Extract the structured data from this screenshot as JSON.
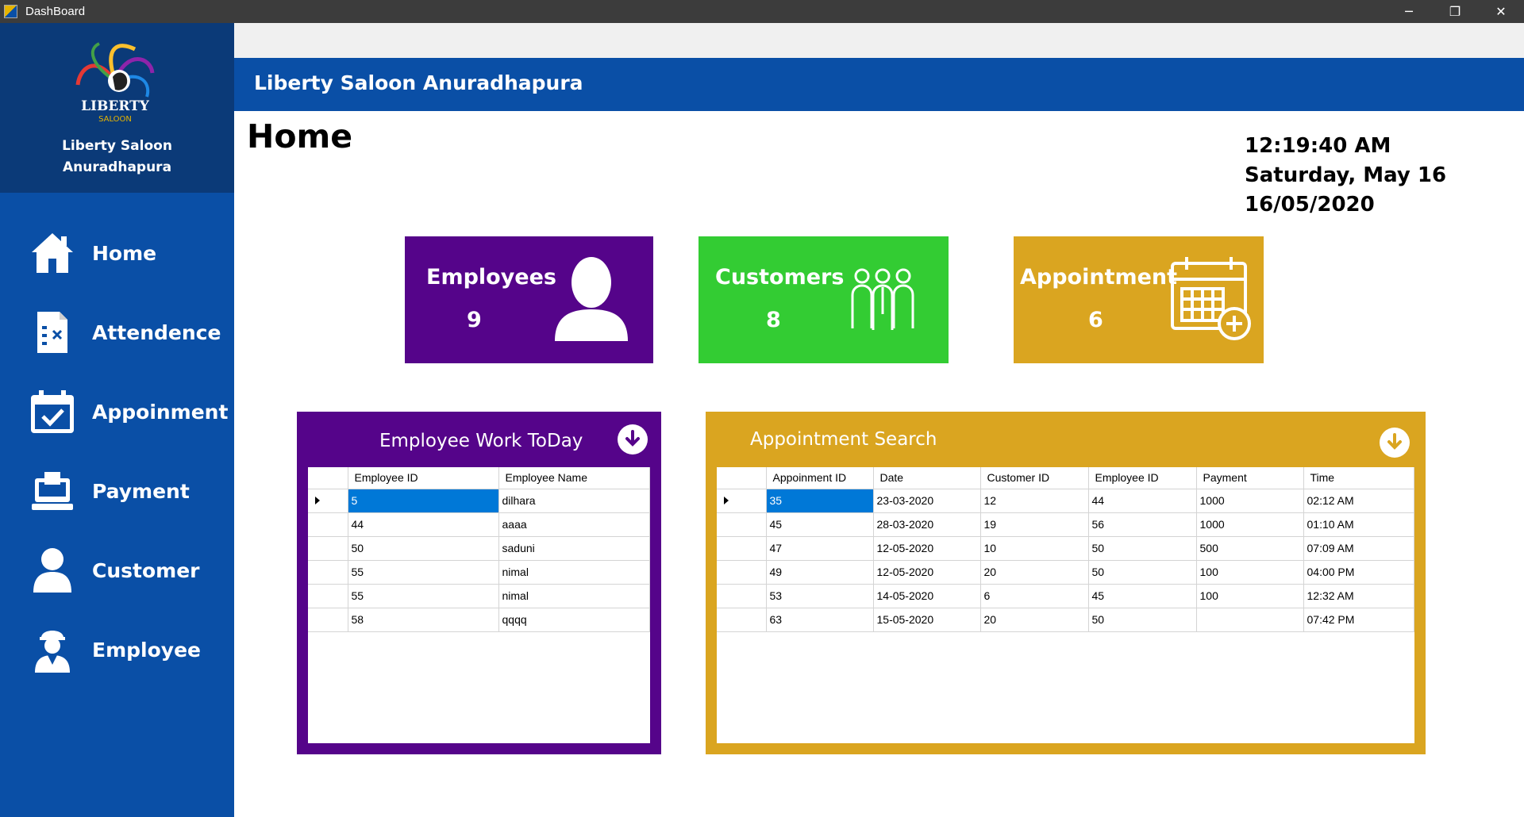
{
  "window": {
    "title": "DashBoard",
    "minimize": "─",
    "maximize": "❐",
    "close": "✕"
  },
  "sidebar": {
    "brand_line1": "Liberty Saloon",
    "brand_line2": "Anuradhapura",
    "logo_icon": "liberty-saloon-logo",
    "items": [
      {
        "label": "Home",
        "icon": "home-icon"
      },
      {
        "label": "Attendence",
        "icon": "attendance-sheet-icon"
      },
      {
        "label": "Appoinment",
        "icon": "calendar-check-icon"
      },
      {
        "label": "Payment",
        "icon": "payment-terminal-icon"
      },
      {
        "label": "Customer",
        "icon": "user-icon"
      },
      {
        "label": "Employee",
        "icon": "worker-icon"
      }
    ]
  },
  "header": {
    "title": "Liberty Saloon Anuradhapura"
  },
  "page": {
    "title": "Home"
  },
  "clock": {
    "time": "12:19:40 AM",
    "day": "Saturday, May 16",
    "date": "16/05/2020"
  },
  "cards": {
    "employees": {
      "label": "Employees",
      "count": "9",
      "color": "#55048a"
    },
    "customers": {
      "label": "Customers",
      "count": "8",
      "color": "#33cc33"
    },
    "appointment": {
      "label": "Appointment",
      "count": "6",
      "color": "#daa520"
    }
  },
  "employee_panel": {
    "title": "Employee Work ToDay",
    "columns": [
      "Employee ID",
      "Employee Name"
    ],
    "rows": [
      [
        "5",
        "dilhara"
      ],
      [
        "44",
        "aaaa"
      ],
      [
        "50",
        "saduni"
      ],
      [
        "55",
        "nimal"
      ],
      [
        "55",
        "nimal"
      ],
      [
        "58",
        "qqqq"
      ]
    ]
  },
  "appointment_panel": {
    "title": "Appointment Search",
    "columns": [
      "Appoinment ID",
      "Date",
      "Customer ID",
      "Employee ID",
      "Payment",
      "Time"
    ],
    "rows": [
      [
        "35",
        "23-03-2020",
        "12",
        "44",
        "1000",
        "02:12 AM"
      ],
      [
        "45",
        "28-03-2020",
        "19",
        "56",
        "1000",
        "01:10 AM"
      ],
      [
        "47",
        "12-05-2020",
        "10",
        "50",
        "500",
        "07:09 AM"
      ],
      [
        "49",
        "12-05-2020",
        "20",
        "50",
        "100",
        "04:00 PM"
      ],
      [
        "53",
        "14-05-2020",
        "6",
        "45",
        "100",
        "12:32 AM"
      ],
      [
        "63",
        "15-05-2020",
        "20",
        "50",
        "",
        "07:42 PM"
      ]
    ]
  },
  "colors": {
    "sidebar": "#0a4fa6",
    "brand": "#0b3a78",
    "selection": "#0078d7"
  }
}
